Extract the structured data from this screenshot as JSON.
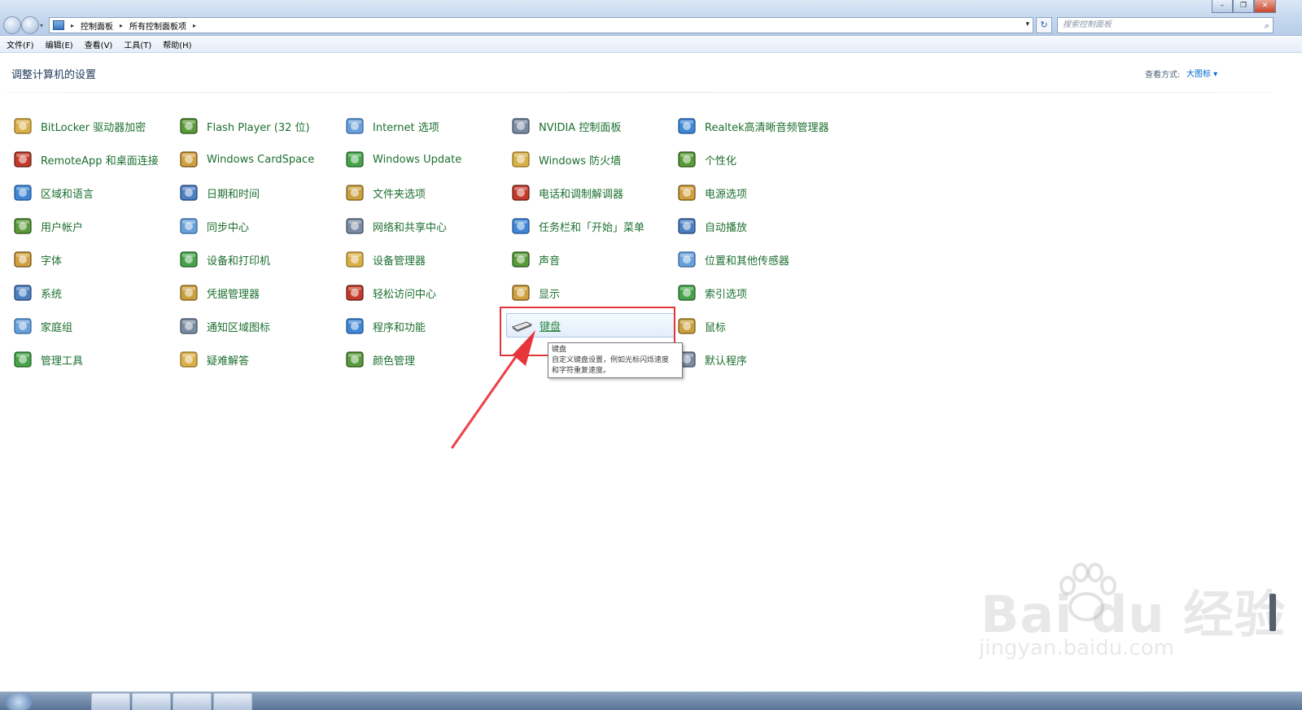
{
  "window": {
    "breadcrumb": [
      "控制面板",
      "所有控制面板项"
    ],
    "search_placeholder": "搜索控制面板"
  },
  "menu": [
    "文件(F)",
    "编辑(E)",
    "查看(V)",
    "工具(T)",
    "帮助(H)"
  ],
  "header": {
    "title": "调整计算机的设置",
    "view_by_label": "查看方式:",
    "view_by_value": "大图标 ▾"
  },
  "columns": [
    [
      "BitLocker 驱动器加密",
      "RemoteApp 和桌面连接",
      "区域和语言",
      "用户帐户",
      "字体",
      "系统",
      "家庭组",
      "管理工具"
    ],
    [
      "Flash Player (32 位)",
      "Windows CardSpace",
      "日期和时间",
      "同步中心",
      "设备和打印机",
      "凭据管理器",
      "通知区域图标",
      "疑难解答"
    ],
    [
      "Internet 选项",
      "Windows Update",
      "文件夹选项",
      "网络和共享中心",
      "设备管理器",
      "轻松访问中心",
      "程序和功能",
      "颜色管理"
    ],
    [
      "NVIDIA 控制面板",
      "Windows 防火墙",
      "电话和调制解调器",
      "任务栏和「开始」菜单",
      "声音",
      "显示",
      "键盘",
      ""
    ],
    [
      "Realtek高清晰音频管理器",
      "个性化",
      "电源选项",
      "自动播放",
      "位置和其他传感器",
      "索引选项",
      "鼠标",
      "默认程序"
    ]
  ],
  "hovered_item": "键盘",
  "tooltip": {
    "title": "键盘",
    "line1": "自定义键盘设置，例如光标闪烁速度",
    "line2": "和字符重复速度。"
  },
  "watermark": {
    "brand": "Bai  du 经验",
    "site": "jingyan.baidu.com"
  },
  "colors": {
    "item_text": "#1c6f2f",
    "highlight": "#e0353a",
    "title_text": "#1e395b"
  }
}
